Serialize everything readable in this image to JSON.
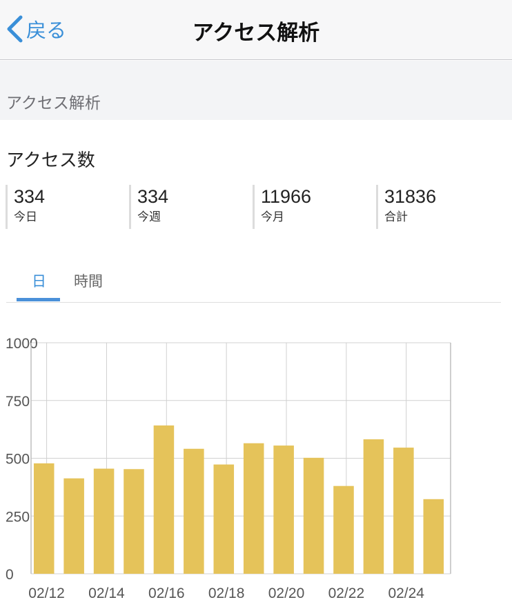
{
  "nav": {
    "back_label": "戻る",
    "title": "アクセス解析"
  },
  "section": {
    "title": "アクセス解析"
  },
  "access": {
    "title": "アクセス数",
    "stats": [
      {
        "value": "334",
        "label": "今日"
      },
      {
        "value": "334",
        "label": "今週"
      },
      {
        "value": "11966",
        "label": "今月"
      },
      {
        "value": "31836",
        "label": "合計"
      }
    ]
  },
  "tabs": [
    {
      "label": "日",
      "active": true
    },
    {
      "label": "時間",
      "active": false
    }
  ],
  "colors": {
    "accent": "#3a8fd8",
    "bar": "#e5c35a",
    "grid": "#d0d0d0"
  },
  "chart_data": {
    "type": "bar",
    "categories": [
      "02/12",
      "02/13",
      "02/14",
      "02/15",
      "02/16",
      "02/17",
      "02/18",
      "02/19",
      "02/20",
      "02/21",
      "02/22",
      "02/23",
      "02/24",
      "02/25"
    ],
    "values": [
      478,
      413,
      455,
      453,
      642,
      541,
      473,
      565,
      555,
      502,
      380,
      582,
      546,
      323
    ],
    "x_tick_labels": [
      "02/12",
      "02/14",
      "02/16",
      "02/18",
      "02/20",
      "02/22",
      "02/24"
    ],
    "y_ticks": [
      "0",
      "250",
      "500",
      "750",
      "1000"
    ],
    "ylim": [
      0,
      1000
    ],
    "grid": true,
    "legend": "none"
  }
}
